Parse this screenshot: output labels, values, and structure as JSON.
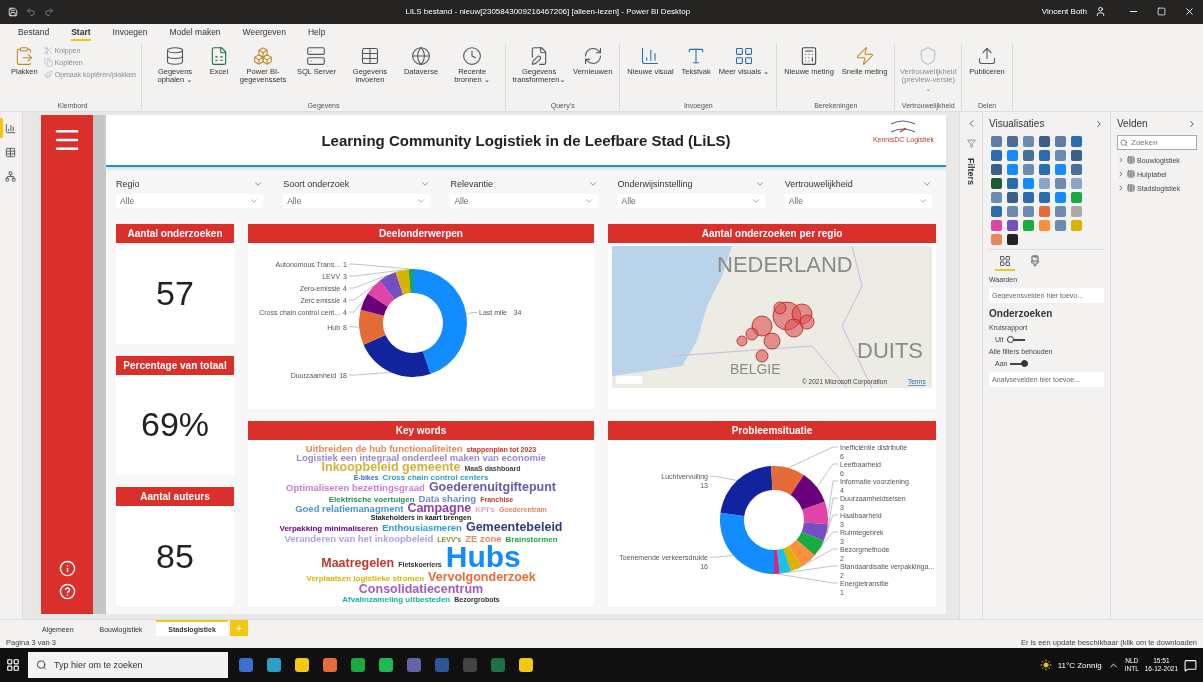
{
  "window": {
    "title": "LiLS bestand - nieuw[2305843009216467206] [alleen-lezen] - Power BI Desktop",
    "user": "Vincent Both"
  },
  "ribbon": {
    "tabs": [
      {
        "label": "Bestand",
        "selected": false
      },
      {
        "label": "Start",
        "selected": true
      },
      {
        "label": "Invoegen",
        "selected": false
      },
      {
        "label": "Model maken",
        "selected": false
      },
      {
        "label": "Weergeven",
        "selected": false
      },
      {
        "label": "Help",
        "selected": false
      }
    ],
    "groups": [
      {
        "label": "Klembord",
        "items": [
          {
            "label": "Plakken",
            "kind": "large",
            "disabled": false
          },
          {
            "label": "Knippen",
            "kind": "small",
            "disabled": true
          },
          {
            "label": "Kopiëren",
            "kind": "small",
            "disabled": true
          },
          {
            "label": "Opmaak kopiëren/plakken",
            "kind": "small",
            "disabled": true
          }
        ]
      },
      {
        "label": "Gegevens",
        "items": [
          {
            "label": "Gegevens ophalen ⌄",
            "kind": "large",
            "disabled": false
          },
          {
            "label": "Excel",
            "kind": "large",
            "disabled": false
          },
          {
            "label": "Power BI-gegevenssets",
            "kind": "large",
            "disabled": false
          },
          {
            "label": "SQL Server",
            "kind": "large",
            "disabled": false
          },
          {
            "label": "Gegevens invoeren",
            "kind": "large",
            "disabled": false
          },
          {
            "label": "Dataverse",
            "kind": "large",
            "disabled": false
          },
          {
            "label": "Recente bronnen ⌄",
            "kind": "large",
            "disabled": false
          }
        ]
      },
      {
        "label": "Query's",
        "items": [
          {
            "label": "Gegevens transformeren⌄",
            "kind": "large",
            "disabled": false
          },
          {
            "label": "Vernieuwen",
            "kind": "large",
            "disabled": false
          }
        ]
      },
      {
        "label": "Invoegen",
        "items": [
          {
            "label": "Nieuwe visual",
            "kind": "large",
            "disabled": false
          },
          {
            "label": "Tekstvak",
            "kind": "large",
            "disabled": false
          },
          {
            "label": "Meer visuals ⌄",
            "kind": "large",
            "disabled": false
          }
        ]
      },
      {
        "label": "Berekeningen",
        "items": [
          {
            "label": "Nieuwe meting",
            "kind": "large",
            "disabled": false
          },
          {
            "label": "Snelle meting",
            "kind": "large",
            "disabled": false
          }
        ]
      },
      {
        "label": "Vertrouwelijkheid",
        "items": [
          {
            "label": "Vertrouwelijkheid (preview-versie) ⌄",
            "kind": "large",
            "disabled": true
          }
        ]
      },
      {
        "label": "Delen",
        "items": [
          {
            "label": "Publiceren",
            "kind": "large",
            "disabled": false
          }
        ]
      }
    ]
  },
  "nav": [
    {
      "selected": true
    },
    {
      "selected": false
    },
    {
      "selected": false
    }
  ],
  "report": {
    "title": "Learning Community Logistiek in de Leefbare Stad (LiLS)",
    "logo": "KennisDC Logistiek",
    "slicers": [
      {
        "label": "Regio",
        "value": "Alle"
      },
      {
        "label": "Soort onderzoek",
        "value": "Alle"
      },
      {
        "label": "Relevantie",
        "value": "Alle"
      },
      {
        "label": "Onderwijsinstelling",
        "value": "Alle"
      },
      {
        "label": "Vertrouwelijkheid",
        "value": "Alle"
      }
    ],
    "kpis": [
      {
        "title": "Aantal onderzoeken",
        "value": "57"
      },
      {
        "title": "Percentage van totaal",
        "value": "69%"
      },
      {
        "title": "Aantal auteurs",
        "value": "85"
      }
    ],
    "topics": {
      "chart_data": {
        "type": "donut",
        "title": "Deelonderwerpen",
        "categories": [
          "Last mile",
          "Duurzaamheid",
          "Hub",
          "Cross chain control cent...",
          "Zerc emissie",
          "Zero-emissie",
          "LEVV",
          "Autonomous Trans..."
        ],
        "colors": [
          "#118dff",
          "#12239e",
          "#e66c37",
          "#6b007b",
          "#e044a7",
          "#744ec2",
          "#d9b300",
          "#1aab40"
        ],
        "values": [
          34,
          18,
          8,
          4,
          4,
          4,
          3,
          1
        ],
        "data_labels": true
      }
    },
    "map": {
      "title": "Aantal onderzoeken per regio",
      "labels": [
        "NEDERLAND",
        "BELGIE",
        "DUITS"
      ],
      "attribution": "© 2021 Microsoft Corporation",
      "terms": "Terms"
    },
    "keywords": {
      "title": "Key words",
      "lines": [
        [
          {
            "text": "Uitbreiden de hub functionaliteiten",
            "kind": "m",
            "color": "#e8875a"
          },
          {
            "text": "stappenplan tot 2023",
            "kind": "xs",
            "color": "#c0392b"
          }
        ],
        [
          {
            "text": "Logistiek een integraal onderdeel maken van economie",
            "kind": "m",
            "color": "#9a86d0"
          }
        ],
        [
          {
            "text": "Inkoopbeleid gemeente",
            "kind": "l",
            "color": "#d1b23a"
          },
          {
            "text": "MaaS dashboard",
            "kind": "xs",
            "color": "#444444"
          }
        ],
        [
          {
            "text": "E-bikes",
            "kind": "xs",
            "color": "#3a6fd0"
          },
          {
            "text": "Cross chain control centers",
            "kind": "s",
            "color": "#2aa0c8"
          }
        ],
        [
          {
            "text": "Optimaliseren bezettingsgraad",
            "kind": "m",
            "color": "#d07ad0"
          },
          {
            "text": "Goederenuitgiftepunt",
            "kind": "l",
            "color": "#6a5aa8"
          }
        ],
        [
          {
            "text": "Elektrische voertuigen",
            "kind": "s",
            "color": "#2e8b57"
          },
          {
            "text": "Data sharing",
            "kind": "m",
            "color": "#6a8ad0"
          },
          {
            "text": "Franchise",
            "kind": "xs",
            "color": "#c0392b"
          }
        ],
        [
          {
            "text": "Goed relatiemanagment",
            "kind": "m",
            "color": "#4a90d9"
          },
          {
            "text": "Campagne",
            "kind": "l",
            "color": "#8e44ad"
          },
          {
            "text": "KPI's",
            "kind": "s",
            "color": "#e8a0c0"
          },
          {
            "text": "Goederentram",
            "kind": "xs",
            "color": "#e8875a"
          }
        ],
        [
          {
            "text": "Stakeholders in kaart brengen",
            "kind": "xs",
            "color": "#222222"
          }
        ],
        [
          {
            "text": "Verpakking minimaliseren",
            "kind": "s",
            "color": "#6b007b"
          },
          {
            "text": "Enthousiasmeren",
            "kind": "m",
            "color": "#2aa0c8"
          },
          {
            "text": "Gemeentebeleid",
            "kind": "l",
            "color": "#2c3e80"
          }
        ],
        [
          {
            "text": "Veranderen van het inkoopbeleid",
            "kind": "m",
            "color": "#b0a0e0"
          },
          {
            "text": "LEVV's",
            "kind": "xs",
            "color": "#8a8a2a"
          },
          {
            "text": "ZE zone",
            "kind": "m",
            "color": "#e8875a"
          },
          {
            "text": "Brainstormen",
            "kind": "s",
            "color": "#1aab40"
          }
        ],
        [
          {
            "text": "Maatregelen",
            "kind": "l",
            "color": "#c0392b"
          },
          {
            "text": "Fietskoeriers",
            "kind": "xs",
            "color": "#333333"
          },
          {
            "text": "Hubs",
            "kind": "xl",
            "color": "#118dff"
          }
        ],
        [
          {
            "text": "Verplaatsen logistieke stromen",
            "kind": "s",
            "color": "#d9b300"
          },
          {
            "text": "Vervolgonderzoek",
            "kind": "l",
            "color": "#e66c37"
          }
        ],
        [
          {
            "text": "Consolidatiecentrum",
            "kind": "l",
            "color": "#a05cc0"
          }
        ],
        [
          {
            "text": "Afvalinzameling uitbesteden",
            "kind": "s",
            "color": "#1ab0a0"
          },
          {
            "text": "Bezorgrobots",
            "kind": "xs",
            "color": "#333333"
          }
        ]
      ]
    },
    "problems": {
      "chart_data": {
        "type": "donut",
        "title": "Probleemsituatie",
        "categories": [
          "Toenemende verkeersdrukte",
          "Luchtvervuiling",
          "Inefficiëntie distributie",
          "Leefbaarheid",
          "Informatie voorziening",
          "Duurzaamheidseisen",
          "Haalbaarheid",
          "Ruimtegebrek",
          "Bezorgmethode",
          "Standaardisatie verpakkinga...",
          "Energietransitie"
        ],
        "colors": [
          "#118dff",
          "#12239e",
          "#e66c37",
          "#6b007b",
          "#e044a7",
          "#744ec2",
          "#1aab40",
          "#fd8f3b",
          "#d9b300",
          "#17c3e5",
          "#c82b8a"
        ],
        "values": [
          16,
          13,
          6,
          6,
          4,
          3,
          3,
          3,
          2,
          2,
          1
        ],
        "data_labels": true
      }
    }
  },
  "filters_label": "Filters",
  "visualizations": {
    "title": "Visualisaties",
    "build_tabs": [
      {
        "selected": true
      },
      {
        "selected": false
      }
    ],
    "values_label": "Waarden",
    "values_placeholder": "Gegevensvelden hier toevo...",
    "section": "Onderzoeken",
    "toggles": [
      {
        "label": "Kruisrapport",
        "state_text": "Uit",
        "on": false
      },
      {
        "label": "Alle filters behouden",
        "state_text": "Aan",
        "on": true
      }
    ],
    "drill_placeholder": "Analysevelden hier toevoe..."
  },
  "fields": {
    "title": "Velden",
    "search_placeholder": "Zoeken",
    "tables": [
      {
        "name": "Bouwlogistiek",
        "expanded": false
      },
      {
        "name": "Hulptabel",
        "expanded": false
      },
      {
        "name": "Stadslogistiek",
        "expanded": false
      }
    ]
  },
  "page_tabs": [
    {
      "label": "Algemeen",
      "selected": false
    },
    {
      "label": "Bouwlogistiek",
      "selected": false
    },
    {
      "label": "Stadslogistiek",
      "selected": true
    }
  ],
  "add_page": "+",
  "status": {
    "page": "Pagina 3 van 3",
    "update": "Er is een update beschikbaar (klik om te downloaden"
  },
  "taskbar": {
    "search_placeholder": "Typ hier om te zoeken",
    "weather": "11°C Zonnig",
    "lang": "NLD",
    "lang_sub": "INTL",
    "time": "15:51",
    "date": "16-12-2021"
  }
}
